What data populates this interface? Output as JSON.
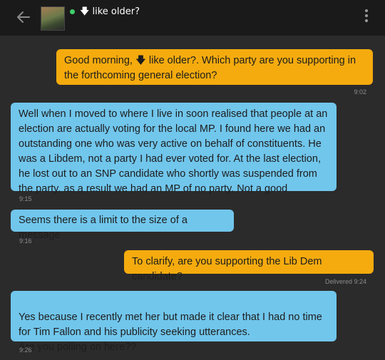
{
  "header": {
    "back_icon": "arrow-left-icon",
    "title": "🡇 like older?",
    "status_color": "#3ecf6a",
    "menu_icon": "more-vertical-icon"
  },
  "messages": [
    {
      "direction": "outgoing",
      "text": "Good morning, 🡇 like older?. Which party are you supporting in the forthcoming general election?",
      "time": "9:02"
    },
    {
      "direction": "incoming",
      "text": "Well when I moved to where I live in soon realised that people at an election are actually voting for the local MP. I  found here we had an outstanding one who was very active on behalf of constituents. He was a Libdem, not a party I had ever voted for. At the last election, he lost out to an SNP candidate who shortly was suspended from the party, as a result we had an MP of no party. Not a good",
      "time": "9:15"
    },
    {
      "direction": "incoming",
      "text": "Seems there is a limit to the size of a message",
      "time": "9:16"
    },
    {
      "direction": "outgoing",
      "text": "To clarify, are you supporting the Lib Dem candidate?",
      "time": "Delivered 9:24"
    },
    {
      "direction": "incoming",
      "text": "Yes because I recently met her but made it clear that I had no time for Tim Fallon and his publicity seeking utterances.\nAre you polling on here??",
      "time": "9:26"
    }
  ],
  "colors": {
    "outgoing_bubble": "#f5ab0e",
    "incoming_bubble": "#71c6ec",
    "background": "#2b2b2b",
    "header": "#1a1a1a"
  }
}
